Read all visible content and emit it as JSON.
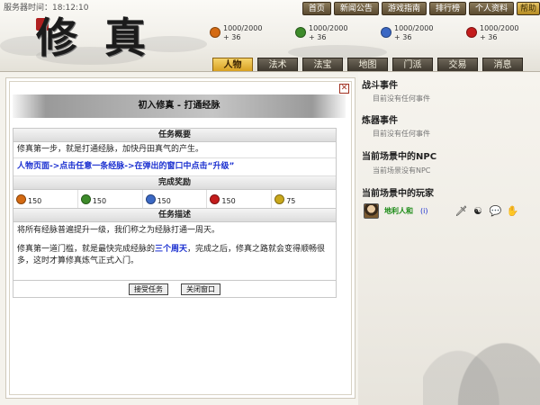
{
  "header": {
    "server_time": "服务器时间：18:12:10",
    "logo": "修真",
    "top_nav": [
      "首页",
      "新闻公告",
      "游戏指南",
      "排行榜",
      "个人资料",
      "帮助"
    ],
    "stats": [
      {
        "value": "1000/2000",
        "delta": "+ 36",
        "color": "#d46a12"
      },
      {
        "value": "1000/2000",
        "delta": "+ 36",
        "color": "#3d8b2a"
      },
      {
        "value": "1000/2000",
        "delta": "+ 36",
        "color": "#3b68c4"
      },
      {
        "value": "1000/2000",
        "delta": "+ 36",
        "color": "#c41c1c"
      }
    ],
    "tabs": [
      "人物",
      "法术",
      "法宝",
      "地图",
      "门派",
      "交易",
      "消息"
    ],
    "active_tab": "人物"
  },
  "quest": {
    "close_label": "✕",
    "title": "初入修真 - 打通经脉",
    "overview_header": "任务概要",
    "overview_text": "修真第一步，就是打通经脉，加快丹田真气的产生。",
    "instruction": "人物页面->点击任意一条经脉->在弹出的窗口中点击“升级”",
    "rewards_header": "完成奖励",
    "rewards": [
      {
        "value": "150",
        "color": "#d46a12"
      },
      {
        "value": "150",
        "color": "#3d8b2a"
      },
      {
        "value": "150",
        "color": "#3b68c4"
      },
      {
        "value": "150",
        "color": "#c41c1c"
      },
      {
        "value": "75",
        "color": "#c9a81c"
      }
    ],
    "desc_header": "任务描述",
    "desc_p1": "将所有经脉普遍提升一级，我们称之为经脉打通一周天。",
    "desc_p2_pre": "修真第一道门槛，就是最快完成经脉的",
    "desc_p2_hl": "三个周天",
    "desc_p2_post": "，完成之后，修真之路就会变得顺畅很多，这时才算修真炼气正式入门。",
    "accept_label": "接受任务",
    "close_window_label": "关闭窗口"
  },
  "sidebar": {
    "battle_heading": "战斗事件",
    "battle_text": "目前没有任何事件",
    "refine_heading": "炼器事件",
    "refine_text": "目前没有任何事件",
    "npc_heading": "当前场景中的NPC",
    "npc_text": "当前场景没有NPC",
    "players_heading": "当前场景中的玩家",
    "player_name": "地利人和",
    "player_info": "(i)",
    "player_actions": [
      {
        "icon": "sword-icon",
        "glyph": "🗡"
      },
      {
        "icon": "yin-yang-icon",
        "glyph": "☯"
      },
      {
        "icon": "chat-icon",
        "glyph": "💬"
      },
      {
        "icon": "hand-icon",
        "glyph": "✋"
      }
    ]
  }
}
